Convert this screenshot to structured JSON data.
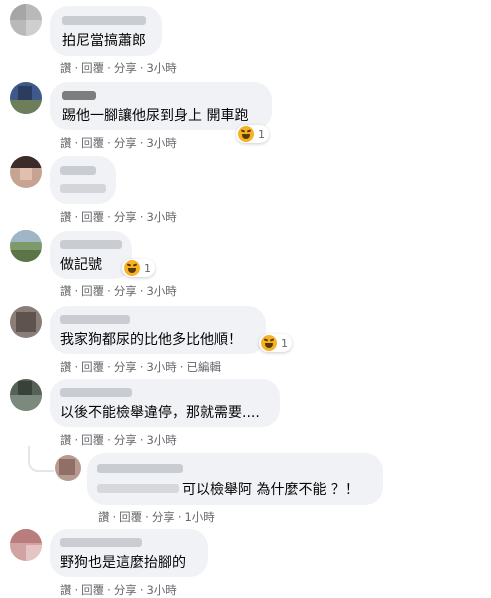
{
  "actions": {
    "like": "讚",
    "reply": "回覆",
    "share": "分享",
    "edited": "已編輯",
    "separator": "·"
  },
  "comments": [
    {
      "text": "拍尼當搞蕭郎",
      "time": "3小時"
    },
    {
      "text": "踢他一腳讓他尿到身上 開車跑",
      "time": "3小時",
      "reaction_count": "1"
    },
    {
      "text": "",
      "time": "3小時"
    },
    {
      "text": "做記號",
      "time": "3小時",
      "reaction_count": "1"
    },
    {
      "text": "我家狗都尿的比他多比他順！",
      "time": "3小時",
      "reaction_count": "1"
    },
    {
      "text": "以後不能檢舉違停，那就需要....",
      "time": "3小時"
    },
    {
      "text": "可以檢舉阿 為什麼不能 ？！",
      "time": "1小時"
    },
    {
      "text": "野狗也是這麼抬腳的",
      "time": "3小時"
    }
  ],
  "colors": {
    "bubble": "#f0f2f5",
    "meta_text": "#65676b",
    "reaction_haha": "#f7b125"
  },
  "icons": {
    "reaction": "haha-icon"
  }
}
